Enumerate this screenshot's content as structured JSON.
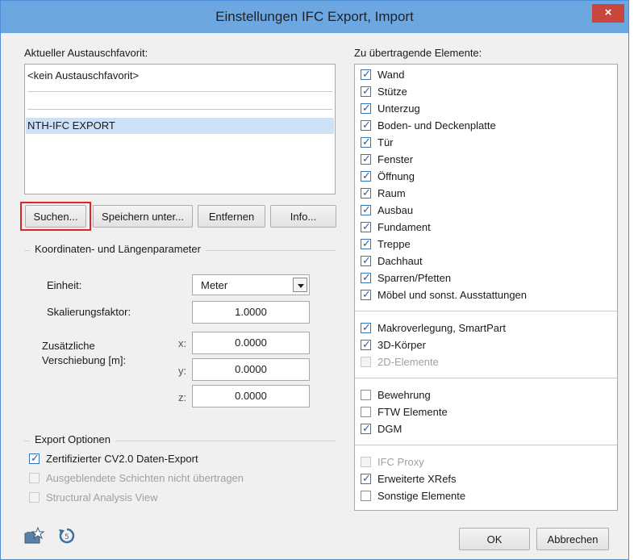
{
  "window": {
    "title": "Einstellungen IFC Export, Import",
    "close_glyph": "×"
  },
  "favorites": {
    "label": "Aktueller Austauschfavorit:",
    "items": [
      "<kein Austauschfavorit>",
      "",
      "",
      "NTH-IFC EXPORT"
    ],
    "selected": "NTH-IFC EXPORT"
  },
  "buttons": {
    "search": "Suchen...",
    "save_as": "Speichern unter...",
    "remove": "Entfernen",
    "info": "Info...",
    "ok": "OK",
    "cancel": "Abbrechen"
  },
  "coords": {
    "group_label": "Koordinaten- und Längenparameter",
    "unit_label": "Einheit:",
    "unit_value": "Meter",
    "scale_label": "Skalierungsfaktor:",
    "scale_value": "1.0000",
    "offset_label_1": "Zusätzliche",
    "offset_label_2": "Verschiebung [m]:",
    "x_label": "x:",
    "x_value": "0.0000",
    "y_label": "y:",
    "y_value": "0.0000",
    "z_label": "z:",
    "z_value": "0.0000"
  },
  "export_options": {
    "group_label": "Export Optionen",
    "items": [
      {
        "label": "Zertifizierter CV2.0 Daten-Export",
        "checked": true,
        "enabled": true
      },
      {
        "label": "Ausgeblendete Schichten nicht übertragen",
        "checked": false,
        "enabled": false
      },
      {
        "label": "Structural Analysis View",
        "checked": false,
        "enabled": false
      }
    ]
  },
  "elements": {
    "label": "Zu übertragende Elemente:",
    "group1": [
      {
        "label": "Wand",
        "checked": true
      },
      {
        "label": "Stütze",
        "checked": true
      },
      {
        "label": "Unterzug",
        "checked": true
      },
      {
        "label": "Boden- und Deckenplatte",
        "checked": true
      },
      {
        "label": "Tür",
        "checked": true
      },
      {
        "label": "Fenster",
        "checked": true
      },
      {
        "label": "Öffnung",
        "checked": true
      },
      {
        "label": "Raum",
        "checked": true
      },
      {
        "label": "Ausbau",
        "checked": true
      },
      {
        "label": "Fundament",
        "checked": true
      },
      {
        "label": "Treppe",
        "checked": true
      },
      {
        "label": "Dachhaut",
        "checked": true
      },
      {
        "label": "Sparren/Pfetten",
        "checked": true
      },
      {
        "label": "Möbel und sonst. Ausstattungen",
        "checked": true
      }
    ],
    "group2": [
      {
        "label": "Makroverlegung, SmartPart",
        "checked": true,
        "enabled": true
      },
      {
        "label": "3D-Körper",
        "checked": true,
        "enabled": true
      },
      {
        "label": "2D-Elemente",
        "checked": false,
        "enabled": false
      }
    ],
    "group3": [
      {
        "label": "Bewehrung",
        "checked": false,
        "enabled": true
      },
      {
        "label": "FTW Elemente",
        "checked": false,
        "enabled": true
      },
      {
        "label": "DGM",
        "checked": true,
        "enabled": true
      }
    ],
    "group4": [
      {
        "label": "IFC Proxy",
        "checked": false,
        "enabled": false
      },
      {
        "label": "Erweiterte XRefs",
        "checked": true,
        "enabled": true
      },
      {
        "label": "Sonstige Elemente",
        "checked": false,
        "enabled": true
      }
    ]
  },
  "icons": {
    "favorite": "star-folder-icon",
    "reset": "reset-icon"
  },
  "colors": {
    "titlebar": "#6da7e2",
    "close": "#c7463d",
    "selection": "#cde0f5",
    "highlight": "#e0232a"
  }
}
